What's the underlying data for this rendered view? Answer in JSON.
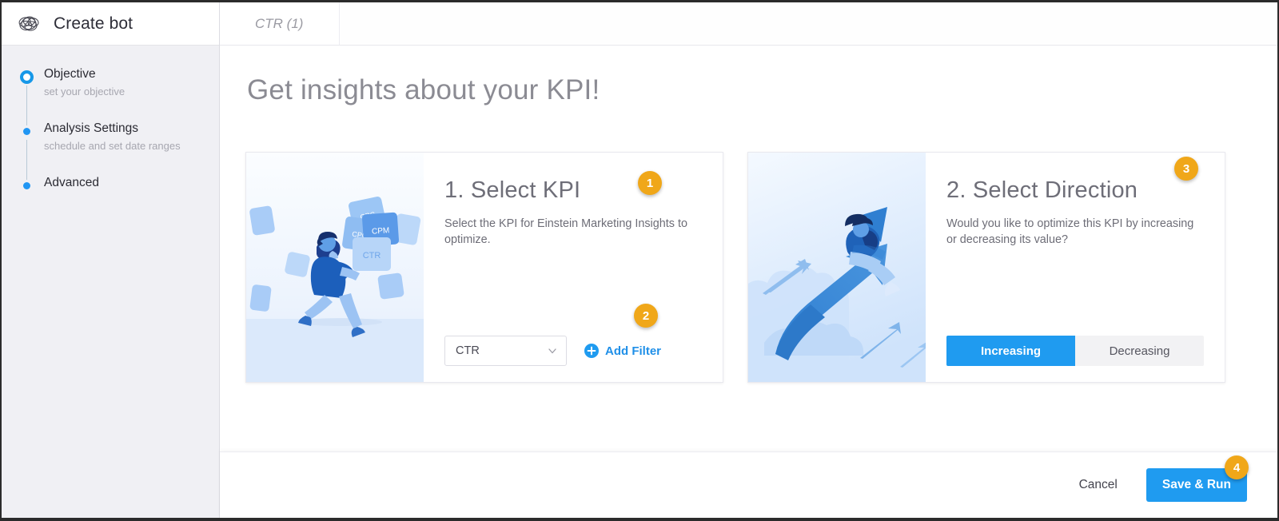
{
  "sidebar": {
    "logo_icon": "einstein-rings-logo-icon",
    "app_title": "Create bot",
    "steps": [
      {
        "title": "Objective",
        "subtitle": "set your objective",
        "state": "active"
      },
      {
        "title": "Analysis Settings",
        "subtitle": "schedule and set date ranges",
        "state": "pending"
      },
      {
        "title": "Advanced",
        "subtitle": "",
        "state": "pending"
      }
    ]
  },
  "tabbar": {
    "tabs": [
      {
        "label": "CTR (1)"
      }
    ]
  },
  "page": {
    "title": "Get insights about your KPI!"
  },
  "cards": [
    {
      "heading": "1. Select KPI",
      "description": "Select the KPI for Einstein Marketing Insights to optimize.",
      "art_name": "runner-with-kpi-cards-illustration",
      "art_labels": [
        "CPC",
        "CPM",
        "CTR"
      ],
      "select": {
        "value": "CTR",
        "chevron_icon": "chevron-down-icon"
      },
      "add_filter": {
        "label": "Add Filter",
        "icon": "plus-circle-icon"
      }
    },
    {
      "heading": "2. Select Direction",
      "description": "Would you like to optimize this KPI by increasing or decreasing its value?",
      "art_name": "person-riding-upward-arrow-illustration",
      "toggle": {
        "options": [
          {
            "label": "Increasing",
            "selected": true
          },
          {
            "label": "Decreasing",
            "selected": false
          }
        ]
      }
    }
  ],
  "callouts": [
    {
      "number": "1"
    },
    {
      "number": "2"
    },
    {
      "number": "3"
    },
    {
      "number": "4"
    }
  ],
  "footer": {
    "cancel_label": "Cancel",
    "save_label": "Save & Run"
  },
  "colors": {
    "accent_blue": "#1f9bf0",
    "badge_orange": "#f0a719",
    "sidebar_bg": "#f0f0f4",
    "text_muted": "#9a9aa2",
    "heading_gray": "#8b8b93"
  }
}
